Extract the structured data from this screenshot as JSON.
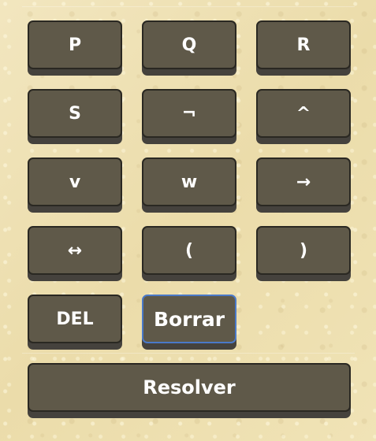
{
  "keypad": {
    "keys": [
      {
        "label": "P"
      },
      {
        "label": "Q"
      },
      {
        "label": "R"
      },
      {
        "label": "S"
      },
      {
        "label": "¬"
      },
      {
        "label": "^"
      },
      {
        "label": "v"
      },
      {
        "label": "w"
      },
      {
        "label": "→"
      },
      {
        "label": "↔"
      },
      {
        "label": "("
      },
      {
        "label": ")"
      }
    ],
    "del_label": "DEL",
    "clear_label": "Borrar",
    "solve_label": "Resolver"
  },
  "colors": {
    "background": "#efe2b6",
    "key_face": "#5f5949",
    "key_border": "#2a2822",
    "key_shadow": "#45423d",
    "focus_border": "#4a79c8",
    "key_text": "#ffffff"
  }
}
